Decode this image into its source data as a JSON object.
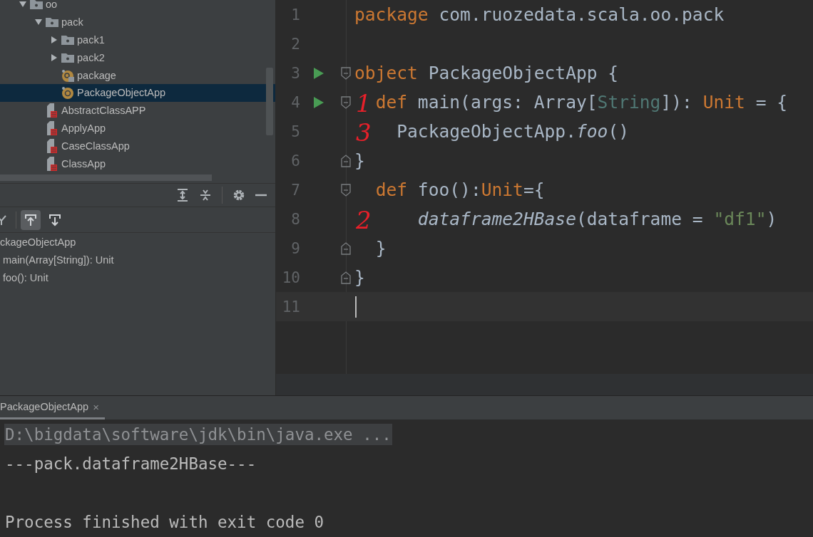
{
  "project_tree": [
    {
      "label": "oo",
      "kind": "folder",
      "expanded": true,
      "selected": false,
      "children": [
        {
          "label": "pack",
          "kind": "folder",
          "expanded": true,
          "selected": false,
          "children": [
            {
              "label": "pack1",
              "kind": "folder",
              "expanded": false,
              "selected": false
            },
            {
              "label": "pack2",
              "kind": "folder",
              "expanded": false,
              "selected": false
            },
            {
              "label": "package",
              "kind": "package-object",
              "selected": false
            },
            {
              "label": "PackageObjectApp",
              "kind": "object",
              "selected": true
            }
          ]
        },
        {
          "label": "AbstractClassAPP",
          "kind": "scala-file",
          "selected": false
        },
        {
          "label": "ApplyApp",
          "kind": "scala-file",
          "selected": false
        },
        {
          "label": "CaseClassApp",
          "kind": "scala-file",
          "selected": false
        },
        {
          "label": "ClassApp",
          "kind": "scala-file",
          "selected": false
        }
      ]
    }
  ],
  "structure": {
    "toolbar": [
      {
        "kind": "sort",
        "selected": false
      },
      {
        "kind": "up",
        "selected": true
      },
      {
        "kind": "down",
        "selected": false
      }
    ],
    "items": [
      {
        "label": "ckageObjectApp",
        "children": [
          {
            "label": "main(Array[String]): Unit"
          },
          {
            "label": "foo(): Unit"
          }
        ]
      }
    ]
  },
  "editor": {
    "lines": [
      {
        "number": "1",
        "run": false,
        "current": false,
        "fold_start": false,
        "fold_end": false,
        "tokens": [
          {
            "kind": "keyword",
            "text": "package"
          },
          {
            "kind": "plain",
            "text": " com.ruozedata.scala.oo.pack"
          }
        ]
      },
      {
        "number": "2",
        "run": false,
        "current": false,
        "fold_start": false,
        "fold_end": false
      },
      {
        "number": "3",
        "run": true,
        "current": false,
        "fold_start": true,
        "fold_end": false,
        "tokens": [
          {
            "kind": "keyword",
            "text": "object"
          },
          {
            "kind": "plain",
            "text": " PackageObjectApp {"
          }
        ]
      },
      {
        "number": "4",
        "run": true,
        "current": false,
        "fold_start": true,
        "fold_end": false,
        "annotation": "1",
        "tokens": [
          {
            "kind": "keyword",
            "text": "  def"
          },
          {
            "kind": "plain",
            "text": " main(args: Array["
          },
          {
            "kind": "type",
            "text": "String"
          },
          {
            "kind": "plain",
            "text": "]): "
          },
          {
            "kind": "keyword",
            "text": "Unit"
          },
          {
            "kind": "plain",
            "text": " = {"
          }
        ]
      },
      {
        "number": "5",
        "run": false,
        "current": false,
        "fold_start": false,
        "fold_end": false,
        "annotation": "3",
        "tokens": [
          {
            "kind": "plain",
            "text": "    PackageObjectApp."
          },
          {
            "kind": "call",
            "text": "foo"
          },
          {
            "kind": "plain",
            "text": "()"
          }
        ]
      },
      {
        "number": "6",
        "run": false,
        "current": false,
        "fold_start": false,
        "fold_end": true,
        "tokens": [
          {
            "kind": "plain",
            "text": "}"
          }
        ]
      },
      {
        "number": "7",
        "run": false,
        "current": false,
        "fold_start": true,
        "fold_end": false,
        "tokens": [
          {
            "kind": "keyword",
            "text": "  def"
          },
          {
            "kind": "plain",
            "text": " foo():"
          },
          {
            "kind": "keyword",
            "text": "Unit"
          },
          {
            "kind": "plain",
            "text": "={"
          }
        ]
      },
      {
        "number": "8",
        "run": false,
        "current": false,
        "fold_start": false,
        "fold_end": false,
        "annotation": "2",
        "tokens": [
          {
            "kind": "call",
            "text": "      dataframe2HBase"
          },
          {
            "kind": "plain",
            "text": "(dataframe = "
          },
          {
            "kind": "string",
            "text": "\"df1\""
          },
          {
            "kind": "plain",
            "text": ")"
          }
        ]
      },
      {
        "number": "9",
        "run": false,
        "current": false,
        "fold_start": false,
        "fold_end": true,
        "tokens": [
          {
            "kind": "plain",
            "text": "  }"
          }
        ]
      },
      {
        "number": "10",
        "run": false,
        "current": false,
        "fold_start": false,
        "fold_end": true,
        "tokens": [
          {
            "kind": "plain",
            "text": "}"
          }
        ]
      },
      {
        "number": "11",
        "run": false,
        "current": true,
        "fold_start": false,
        "fold_end": false
      }
    ]
  },
  "run_panel": {
    "tabs": [
      {
        "label": "PackageObjectApp",
        "close": "×",
        "selected": true
      }
    ],
    "lines": [
      {
        "kind": "command",
        "text": "D:\\bigdata\\software\\jdk\\bin\\java.exe ..."
      },
      {
        "kind": "output",
        "text": "---pack.dataframe2HBase---"
      },
      {
        "kind": "blank"
      },
      {
        "kind": "output",
        "text": "Process finished with exit code 0"
      }
    ]
  }
}
